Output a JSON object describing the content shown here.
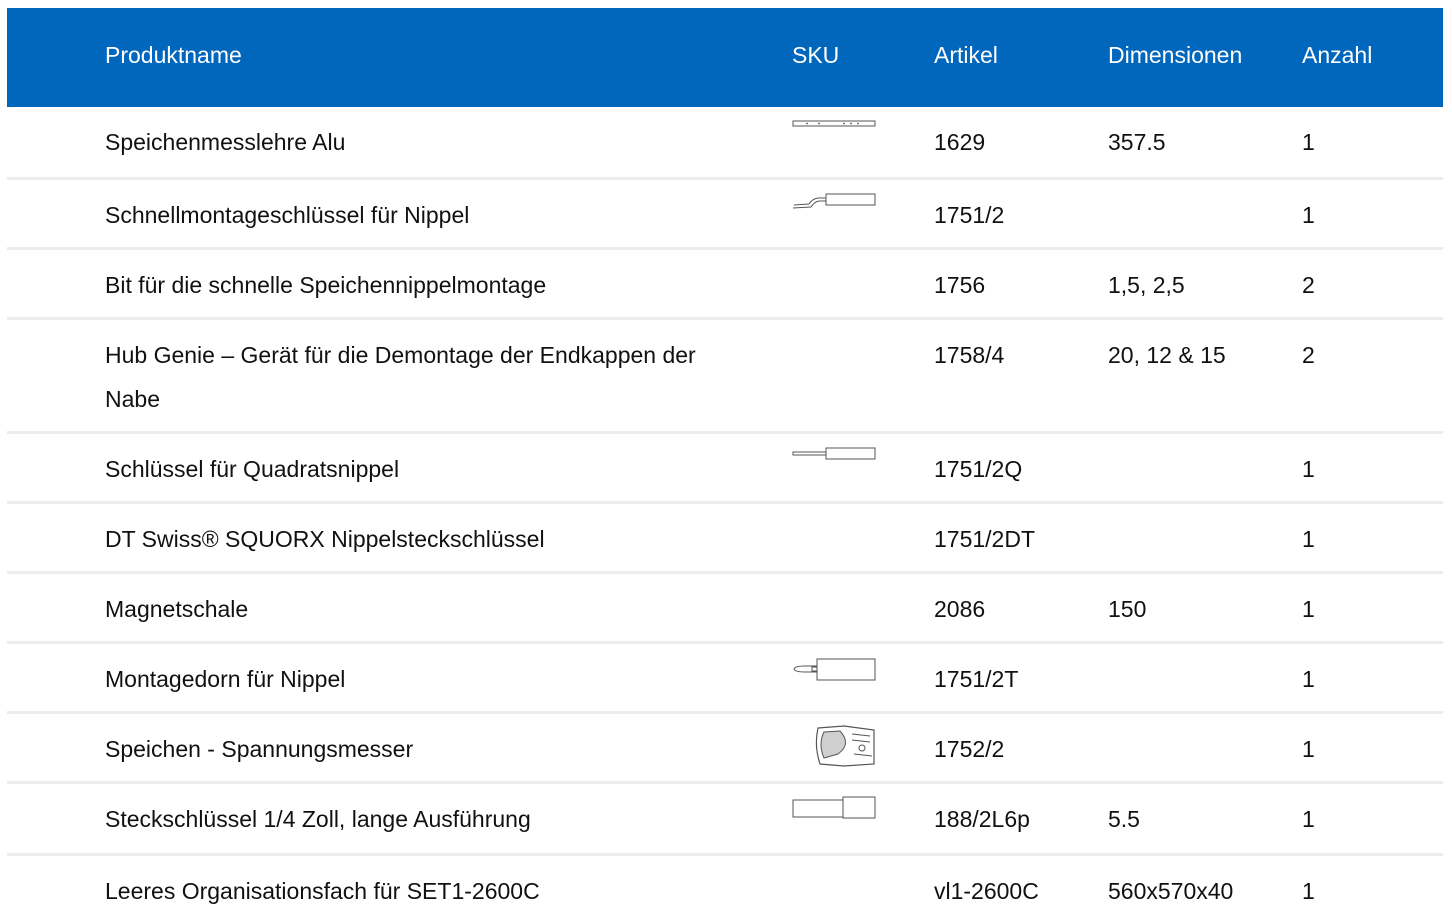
{
  "header": {
    "name": "Produktname",
    "sku": "SKU",
    "article": "Artikel",
    "dimensions": "Dimensionen",
    "quantity": "Anzahl"
  },
  "rows": [
    {
      "name": "Speichenmesslehre Alu",
      "article": "1629",
      "dimensions": "357.5",
      "quantity": "1",
      "icon": "ruler-gauge-icon"
    },
    {
      "name": "Schnellmontageschlüssel für Nippel",
      "article": "1751/2",
      "dimensions": "",
      "quantity": "1",
      "icon": "nipple-driver-icon"
    },
    {
      "name": "Bit für die schnelle Speichennippelmontage",
      "article": "1756",
      "dimensions": "1,5, 2,5",
      "quantity": "2",
      "icon": ""
    },
    {
      "name": "Hub Genie – Gerät für die Demontage der Endkappen der Nabe",
      "article": "1758/4",
      "dimensions": "20, 12 & 15",
      "quantity": "2",
      "icon": ""
    },
    {
      "name": "Schlüssel für Quadratsnippel",
      "article": "1751/2Q",
      "dimensions": "",
      "quantity": "1",
      "icon": "screwdriver-icon"
    },
    {
      "name": "DT Swiss® SQUORX Nippelsteckschlüssel",
      "article": "1751/2DT",
      "dimensions": "",
      "quantity": "1",
      "icon": ""
    },
    {
      "name": "Magnetschale",
      "article": "2086",
      "dimensions": "150",
      "quantity": "1",
      "icon": ""
    },
    {
      "name": "Montagedorn für Nippel",
      "article": "1751/2T",
      "dimensions": "",
      "quantity": "1",
      "icon": "mandrel-icon"
    },
    {
      "name": "Speichen - Spannungsmesser",
      "article": "1752/2",
      "dimensions": "",
      "quantity": "1",
      "icon": "tension-meter-icon"
    },
    {
      "name": "Steckschlüssel 1/4 Zoll, lange Ausführung",
      "article": "188/2L6p",
      "dimensions": "5.5",
      "quantity": "1",
      "icon": "socket-wrench-icon"
    },
    {
      "name": "Leeres Organisationsfach für SET1-2600C",
      "article": "vl1-2600C",
      "dimensions": "560x570x40",
      "quantity": "1",
      "icon": ""
    }
  ]
}
